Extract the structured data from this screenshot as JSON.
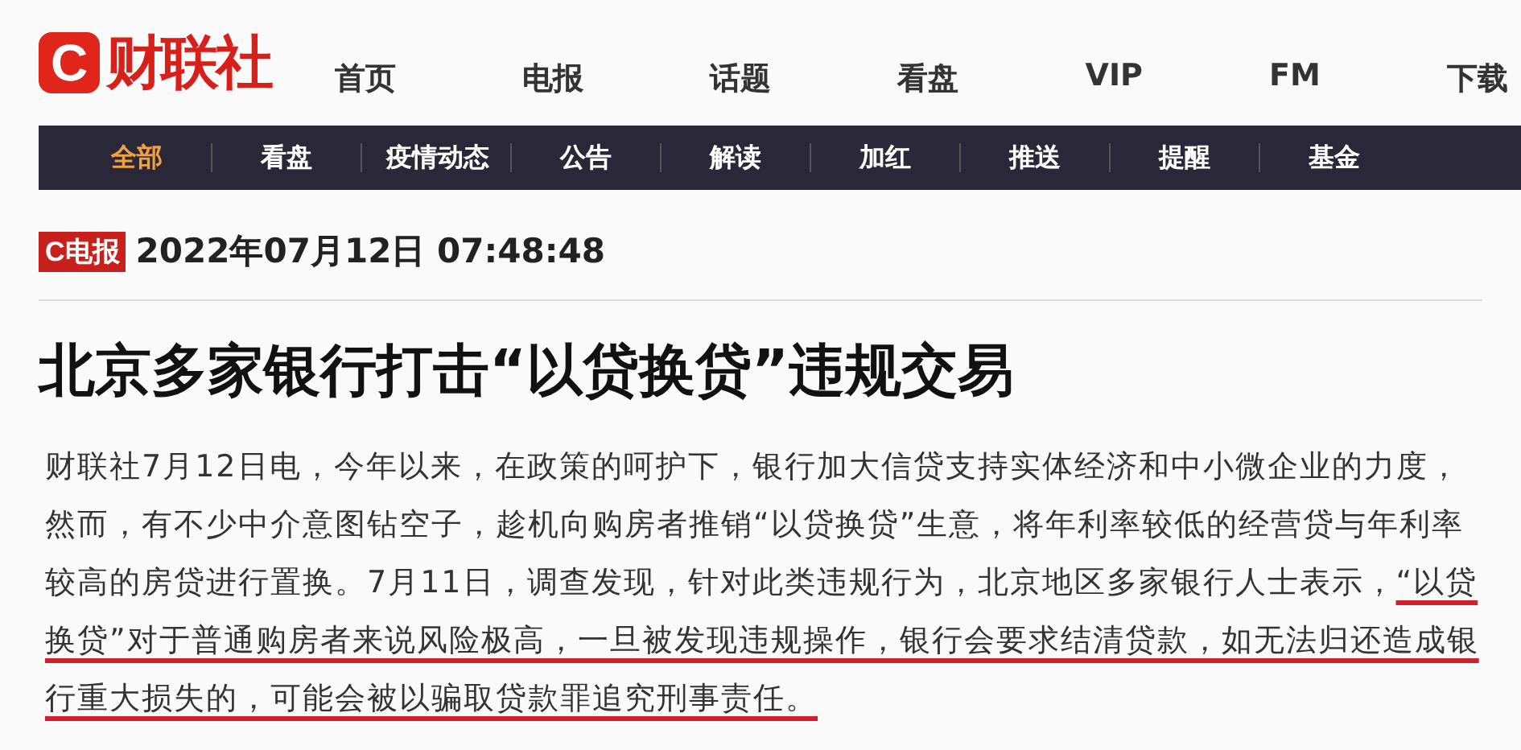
{
  "logo": {
    "mark": "C",
    "name": "财联社"
  },
  "top_nav": [
    "首页",
    "电报",
    "话题",
    "看盘",
    "VIP",
    "FM",
    "下载"
  ],
  "sub_nav": [
    {
      "label": "全部",
      "selected": true
    },
    {
      "label": "看盘",
      "selected": false
    },
    {
      "label": "疫情动态",
      "selected": false
    },
    {
      "label": "公告",
      "selected": false
    },
    {
      "label": "解读",
      "selected": false
    },
    {
      "label": "加红",
      "selected": false
    },
    {
      "label": "推送",
      "selected": false
    },
    {
      "label": "提醒",
      "selected": false
    },
    {
      "label": "基金",
      "selected": false
    }
  ],
  "article": {
    "badge": {
      "mark": "C",
      "text": "电报"
    },
    "datetime": "2022年07月12日 07:48:48",
    "headline": "北京多家银行打击“以贷换贷”违规交易",
    "body": [
      {
        "text": "财联社7月12日电，今年以来，在政策的呵护下，银行加大信贷支持实体经济和中小微企业的力度，然而，有不少中介意图钻空子，趁机向购房者推销“以贷换贷”生意，将年利率较低的经营贷与年利率较高的房贷进行置换。7月11日，调查发现，针对此类违规行为，北京地区多家银行人士表示，",
        "underlined": false
      },
      {
        "text": "“以贷换贷”对于普通购房者来说风险极高，一旦被发现违规操作，银行会要求结清贷款，如无法归还造成银行重大损失的，可能会被以骗取贷款罪追究刑事责任。",
        "underlined": true
      }
    ]
  }
}
